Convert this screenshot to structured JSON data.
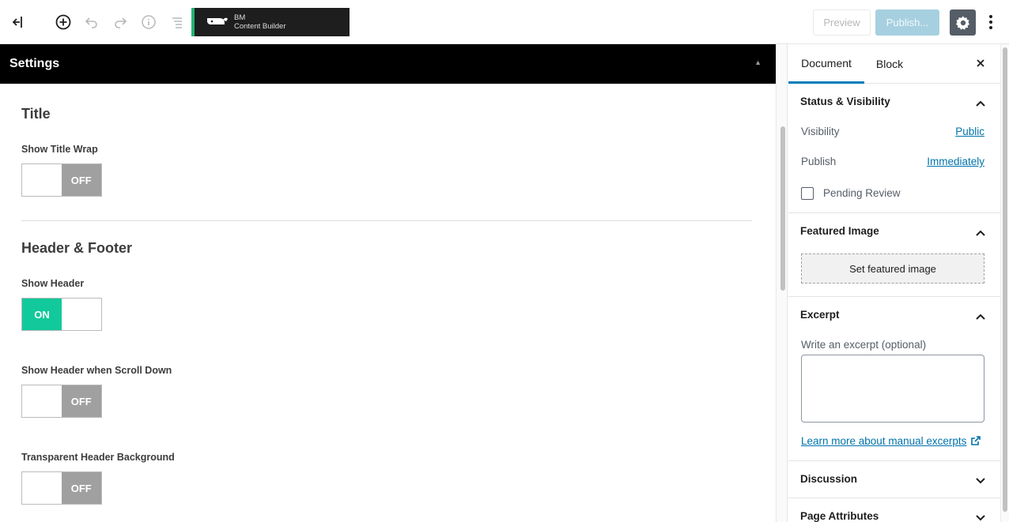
{
  "toolbar": {
    "brand_line1": "BM",
    "brand_line2": "Content Builder",
    "preview_label": "Preview",
    "publish_label": "Publish...",
    "icons": [
      "exit-icon",
      "add-block-icon",
      "undo-icon",
      "redo-icon",
      "info-icon",
      "outline-list-icon",
      "settings-gear-icon",
      "more-vertical-icon"
    ]
  },
  "settings_panel": {
    "title": "Settings",
    "collapse_glyph": "▲",
    "sections": {
      "title": {
        "heading": "Title",
        "fields": [
          {
            "label": "Show Title Wrap",
            "state": "OFF"
          }
        ]
      },
      "header_footer": {
        "heading": "Header & Footer",
        "fields": [
          {
            "label": "Show Header",
            "state": "ON"
          },
          {
            "label": "Show Header when Scroll Down",
            "state": "OFF"
          },
          {
            "label": "Transparent Header Background",
            "state": "OFF"
          }
        ]
      }
    },
    "toggle_colors": {
      "on": "#12c99b",
      "off": "#a0a0a0"
    }
  },
  "sidebar": {
    "tabs": [
      {
        "label": "Document",
        "active": true
      },
      {
        "label": "Block",
        "active": false
      }
    ],
    "status_visibility": {
      "title": "Status & Visibility",
      "visibility_label": "Visibility",
      "visibility_value": "Public",
      "publish_label": "Publish",
      "publish_value": "Immediately",
      "pending_review_label": "Pending Review",
      "pending_review_checked": false
    },
    "featured_image": {
      "title": "Featured Image",
      "button_label": "Set featured image"
    },
    "excerpt": {
      "title": "Excerpt",
      "field_label": "Write an excerpt (optional)",
      "value": "",
      "learn_more": "Learn more about manual excerpts"
    },
    "discussion": {
      "title": "Discussion"
    },
    "page_attributes": {
      "title": "Page Attributes"
    }
  },
  "colors": {
    "accent": "#007cba",
    "link": "#0073aa",
    "publish_disabled": "#a6d0e0",
    "brand_stripe": "#22b573"
  }
}
